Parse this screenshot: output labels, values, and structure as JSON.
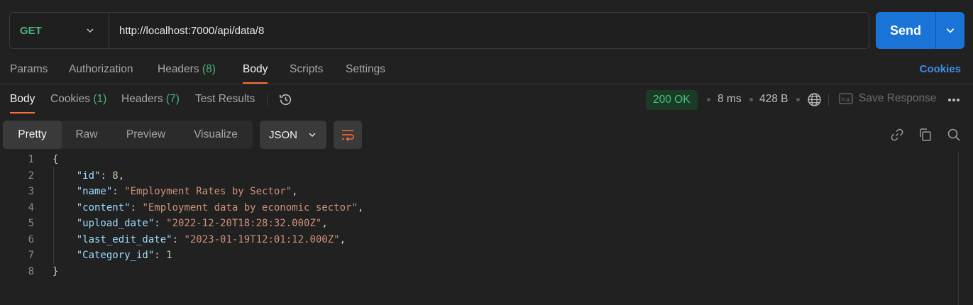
{
  "request": {
    "method": "GET",
    "url": "http://localhost:7000/api/data/8",
    "send_label": "Send"
  },
  "request_tabs": [
    {
      "label": "Params"
    },
    {
      "label": "Authorization"
    },
    {
      "label": "Headers",
      "count": "(8)"
    },
    {
      "label": "Body"
    },
    {
      "label": "Scripts"
    },
    {
      "label": "Settings"
    }
  ],
  "cookies_link": "Cookies",
  "response_tabs": [
    {
      "label": "Body"
    },
    {
      "label": "Cookies",
      "count": "(1)"
    },
    {
      "label": "Headers",
      "count": "(7)"
    },
    {
      "label": "Test Results"
    }
  ],
  "status": {
    "code": "200 OK",
    "time": "8 ms",
    "size": "428 B",
    "save_label": "Save Response"
  },
  "view_modes": [
    "Pretty",
    "Raw",
    "Preview",
    "Visualize"
  ],
  "format": "JSON",
  "code_lines": [
    {
      "n": "1",
      "parts": [
        [
          "punc",
          "{"
        ]
      ]
    },
    {
      "n": "2",
      "parts": [
        [
          "key",
          "    \"id\""
        ],
        [
          "punc",
          ": "
        ],
        [
          "num",
          "8"
        ],
        [
          "punc",
          ","
        ]
      ]
    },
    {
      "n": "3",
      "parts": [
        [
          "key",
          "    \"name\""
        ],
        [
          "punc",
          ": "
        ],
        [
          "str",
          "\"Employment Rates by Sector\""
        ],
        [
          "punc",
          ","
        ]
      ]
    },
    {
      "n": "4",
      "parts": [
        [
          "key",
          "    \"content\""
        ],
        [
          "punc",
          ": "
        ],
        [
          "str",
          "\"Employment data by economic sector\""
        ],
        [
          "punc",
          ","
        ]
      ]
    },
    {
      "n": "5",
      "parts": [
        [
          "key",
          "    \"upload_date\""
        ],
        [
          "punc",
          ": "
        ],
        [
          "str",
          "\"2022-12-20T18:28:32.000Z\""
        ],
        [
          "punc",
          ","
        ]
      ]
    },
    {
      "n": "6",
      "parts": [
        [
          "key",
          "    \"last_edit_date\""
        ],
        [
          "punc",
          ": "
        ],
        [
          "str",
          "\"2023-01-19T12:01:12.000Z\""
        ],
        [
          "punc",
          ","
        ]
      ]
    },
    {
      "n": "7",
      "parts": [
        [
          "key",
          "    \"Category_id\""
        ],
        [
          "punc",
          ": "
        ],
        [
          "num",
          "1"
        ]
      ]
    },
    {
      "n": "8",
      "parts": [
        [
          "punc",
          "}"
        ]
      ]
    }
  ]
}
